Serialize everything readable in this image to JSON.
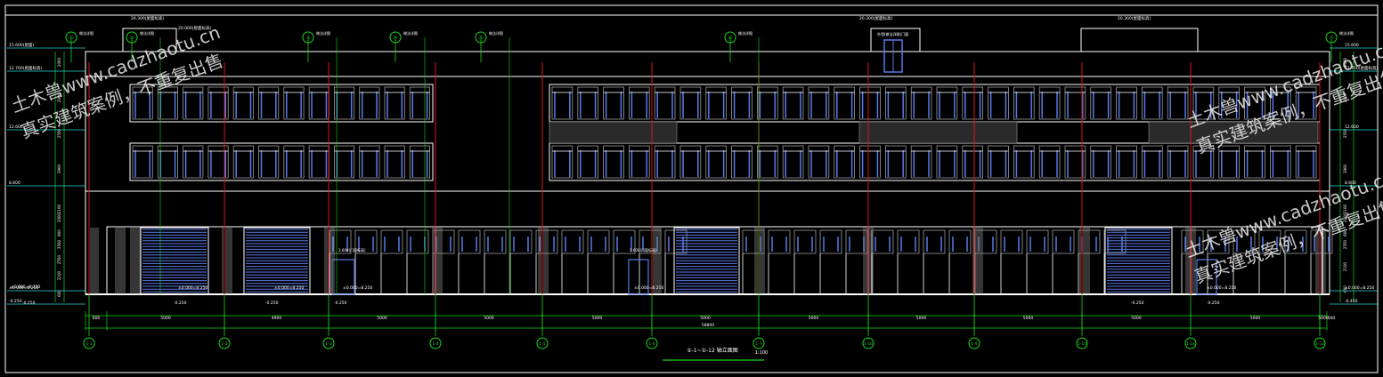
{
  "drawing": {
    "title": "①-1~①-12 轴立面图",
    "scale": "1:100",
    "overall_dimension": "58800",
    "bay_dimensions": [
      "600",
      "5000",
      "4900",
      "5000",
      "5000",
      "5000",
      "5000",
      "5000",
      "5000",
      "5000",
      "5000",
      "5000",
      "5000",
      "500"
    ],
    "grid_labels": [
      "1-1",
      "1-2",
      "1-3",
      "1-4",
      "1-5",
      "1-6",
      "1-7",
      "1-10",
      "1-9",
      "1-10",
      "1-11",
      "1-12"
    ],
    "top_tags": [
      "①",
      "②",
      "③",
      "④",
      "⑤",
      "⑥",
      "⑦"
    ],
    "top_tag_notes": [
      "做法详图",
      "做法详图",
      "做法详图",
      "做法详图",
      "做法详图",
      "做法详图",
      "做法详图"
    ],
    "roof_notes": [
      "20.300(屋面标高)",
      "20.000(屋面标高)",
      "20.300(屋面标高)",
      "20.300(屋面标高)"
    ],
    "rooftop_box_note": "外墙(做法详图)门窗",
    "left_levels": [
      "15.600(屋面)",
      "12.700(屋面标高)",
      "12.600",
      "8.600",
      "±0.000=8.250",
      "-0.250"
    ],
    "right_levels": [
      "15.600",
      "12.700(屋面标高)",
      "12.600",
      "8.600",
      "±0.000=8.250",
      "-0.450"
    ],
    "ground_notes": [
      "±0.000=8.250",
      "±0.000=8.250",
      "±0.000=8.250",
      "±0.000=8.250",
      "±0.000=8.250",
      "±0.000=8.250"
    ],
    "ground_minus": [
      "-0.250",
      "-0.250",
      "-0.250",
      "-0.250",
      "-0.250",
      "-0.250"
    ],
    "ground_floor_notes": [
      "3.600(门窗标高)",
      "3.600(门窗标高)"
    ],
    "left_dims": [
      "2000",
      "2000",
      "2550",
      "3900",
      "2100",
      "2000",
      "800",
      "3500",
      "2550",
      "2100",
      "600"
    ],
    "right_dims": [
      "2000",
      "2000",
      "2550",
      "3900",
      "2100",
      "2000",
      "800",
      "2550",
      "2100",
      "600"
    ]
  },
  "watermarks": [
    {
      "line1": "土木兽www.cadzhaotu.cn",
      "line2": "真实建筑案例，不重复出售"
    },
    {
      "line1": "土木兽www.cadzhaotu.cn",
      "line2": "真实建筑案例，不重复出售"
    },
    {
      "line1": "土木兽www.cadzhaotu.cn",
      "line2": "真实建筑案例，不重复出售"
    }
  ],
  "colors": {
    "background": "#000000",
    "frame": "#ffffff",
    "green": "#19d619",
    "cyan": "#27d8d8",
    "red": "#d61919",
    "blue": "#5b79e6",
    "white": "#ffffff",
    "grey": "#9a9a9a"
  }
}
